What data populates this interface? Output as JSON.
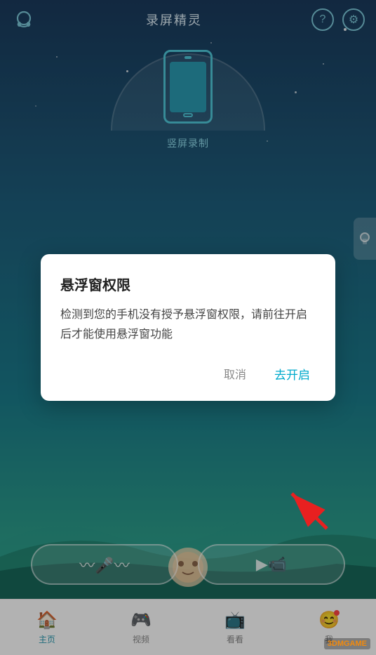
{
  "app": {
    "title": "录屏精灵",
    "header": {
      "left_icon": "headphone-icon",
      "help_label": "?",
      "settings_label": "⚙"
    }
  },
  "main": {
    "record_label": "竖屏录制",
    "action_buttons": {
      "audio_label": "声音",
      "video_label": "视频"
    }
  },
  "dialog": {
    "title": "悬浮窗权限",
    "body": "检测到您的手机没有授予悬浮窗权限，请前往开启后才能使用悬浮窗功能",
    "cancel": "取消",
    "confirm": "去开启"
  },
  "bottom_nav": {
    "items": [
      {
        "label": "主页",
        "active": true
      },
      {
        "label": "视频",
        "active": false
      },
      {
        "label": "看看",
        "active": false
      },
      {
        "label": "我",
        "active": false
      }
    ]
  }
}
